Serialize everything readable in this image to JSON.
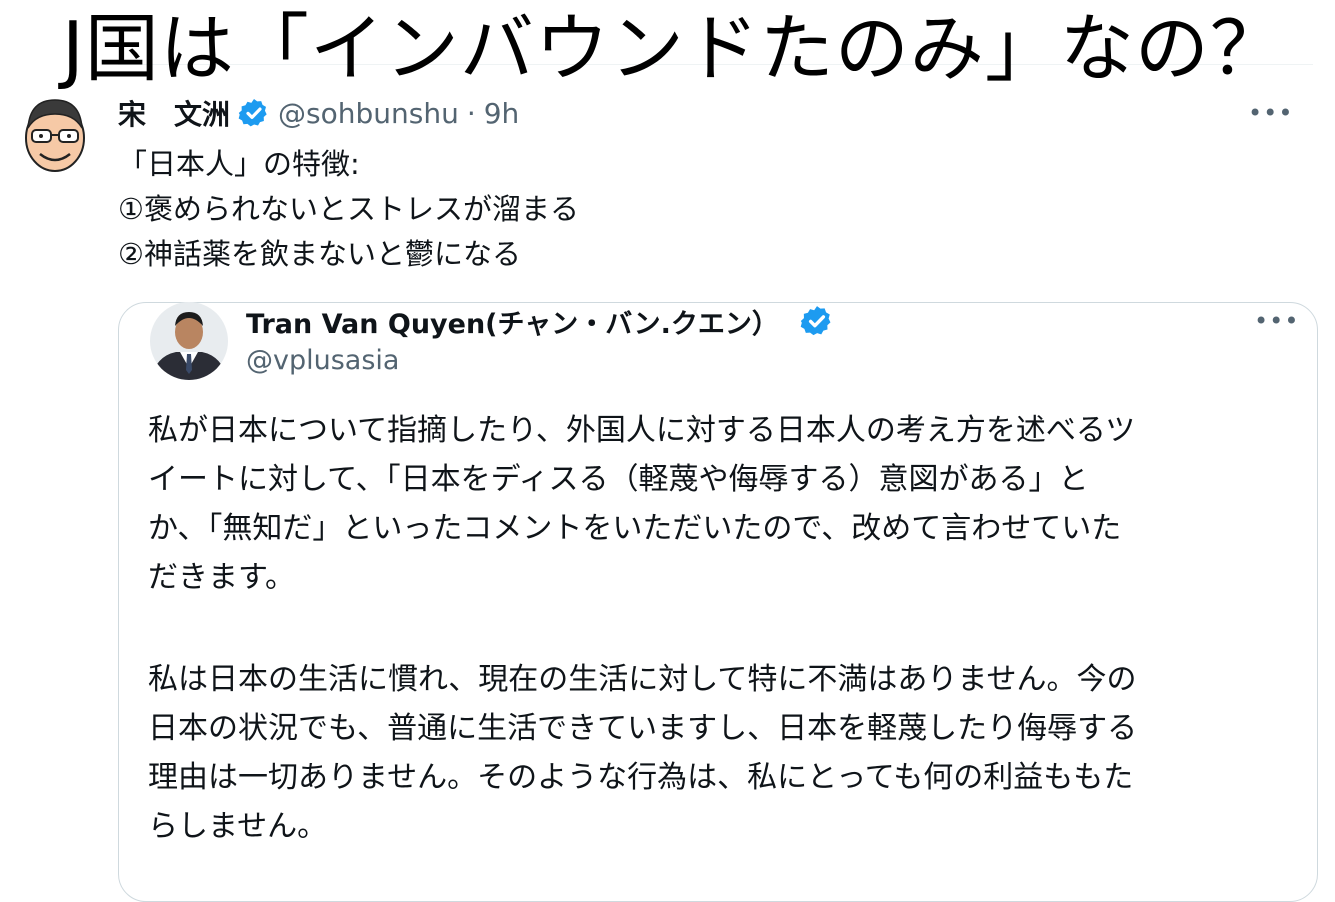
{
  "overlay": {
    "title": "J国は「インバウンドたのみ」なの？"
  },
  "tweet": {
    "author_name": "宋　文洲",
    "handle": "@sohbunshu",
    "separator": "·",
    "time": "9h",
    "more": "•••",
    "lines": [
      "「日本人」の特徴:",
      "①褒められないとストレスが溜まる",
      "②神話薬を飲まないと鬱になる"
    ]
  },
  "quote": {
    "author_name": "Tran Van Quyen(チャン・バン.クエン）",
    "handle": "@vplusasia",
    "more": "•••",
    "paragraph1": [
      "私が日本について指摘したり、外国人に対する日本人の考え方を述べるツ",
      "イートに対して、「日本をディスる（軽蔑や侮辱する）意図がある」と",
      "か、「無知だ」といったコメントをいただいたので、改めて言わせていた",
      "だきます。"
    ],
    "paragraph2": [
      "私は日本の生活に慣れ、現在の生活に対して特に不満はありません。今の",
      "日本の状況でも、普通に生活できていますし、日本を軽蔑したり侮辱する",
      "理由は一切ありません。そのような行為は、私にとっても何の利益ももた",
      "らしません。"
    ]
  },
  "colors": {
    "text": "#0f1419",
    "secondary": "#536471",
    "verified": "#1d9bf0",
    "border": "#cfd9de"
  },
  "icons": {
    "verified": "verified-badge-icon",
    "more": "more-options-icon"
  }
}
